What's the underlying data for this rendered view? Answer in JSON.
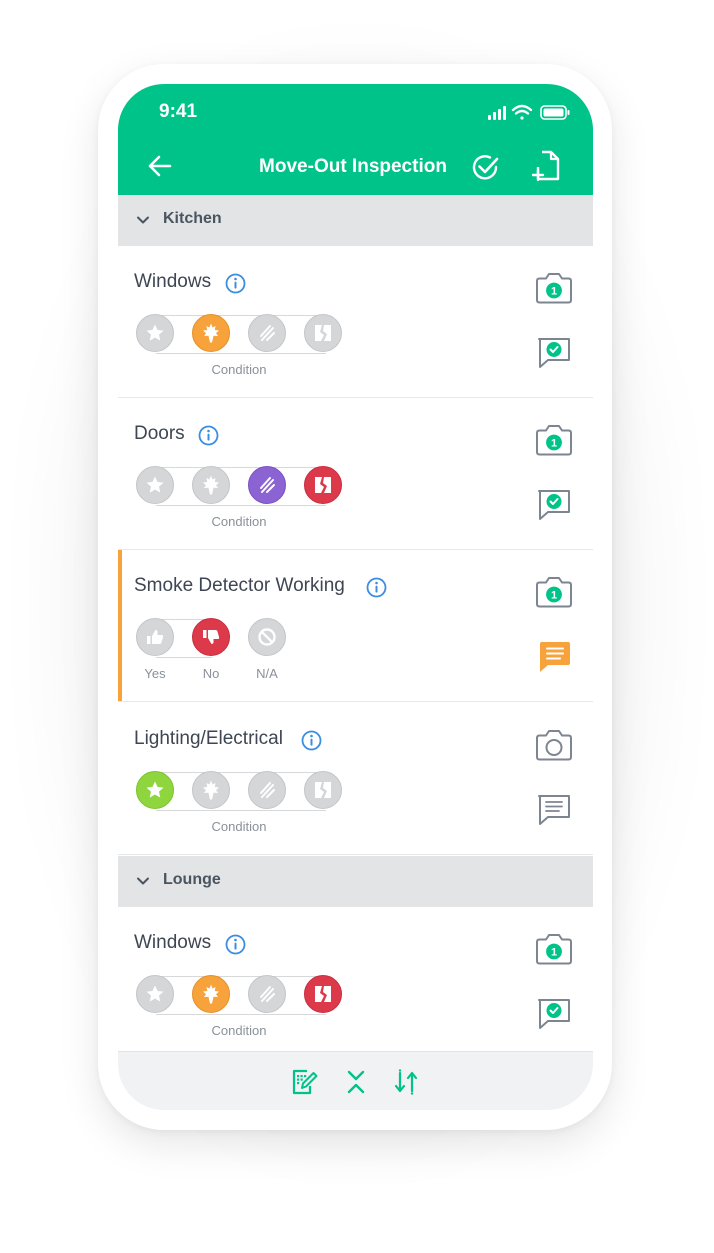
{
  "status_bar": {
    "time": "9:41"
  },
  "header": {
    "title": "Move-Out Inspection"
  },
  "colors": {
    "brand_green": "#00c389",
    "good_green": "#8fd63e",
    "wear_orange": "#f7a23b",
    "scratch_purple": "#8b63d3",
    "broken_red": "#dc3a4b",
    "neutral_grey": "#d5d6d8"
  },
  "sections": [
    {
      "label": "Kitchen",
      "items": [
        {
          "title": "Windows",
          "rating_type": "condition",
          "caption": "Condition",
          "selected": "wear",
          "photo_count": "1",
          "note": "done"
        },
        {
          "title": "Doors",
          "rating_type": "condition",
          "caption": "Condition",
          "selected": [
            "scratched",
            "broken"
          ],
          "photo_count": "1",
          "note": "done"
        },
        {
          "title": "Smoke Detector Working",
          "rating_type": "yes_no_na",
          "labels": [
            "Yes",
            "No",
            "N/A"
          ],
          "selected": "no",
          "photo_count": "1",
          "note": "flagged"
        },
        {
          "title": "Lighting/Electrical",
          "rating_type": "condition",
          "caption": "Condition",
          "selected": "good",
          "photo_count": "",
          "note": "empty"
        }
      ]
    },
    {
      "label": "Lounge",
      "items": [
        {
          "title": "Windows",
          "rating_type": "condition",
          "caption": "Condition",
          "selected": [
            "wear",
            "broken"
          ],
          "photo_count": "1",
          "note": "done"
        }
      ]
    }
  ],
  "icons": {
    "condition_scale": [
      "star-icon",
      "leaf-wear-icon",
      "scratch-icon",
      "broken-icon"
    ],
    "yes_no_scale": [
      "thumbs-up-icon",
      "thumbs-down-icon",
      "not-applicable-icon"
    ],
    "toolbar": [
      "edit-grid-icon",
      "collapse-icon",
      "sort-icon"
    ]
  }
}
